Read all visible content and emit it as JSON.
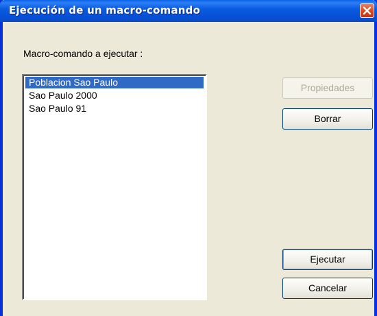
{
  "window": {
    "title": "Ejecución de un macro-comando"
  },
  "label": "Macro-comando a ejecutar :",
  "list": {
    "items": [
      "Poblacion Sao Paulo",
      "Sao Paulo 2000",
      "Sao Paulo 91"
    ],
    "selected_index": 0
  },
  "buttons": {
    "propiedades": "Propiedades",
    "borrar": "Borrar",
    "ejecutar": "Ejecutar",
    "cancelar": "Cancelar"
  },
  "colors": {
    "titlebar": "#0650d6",
    "selection": "#316ac5",
    "close": "#d9461f"
  },
  "icons": {
    "close": "close-icon"
  }
}
